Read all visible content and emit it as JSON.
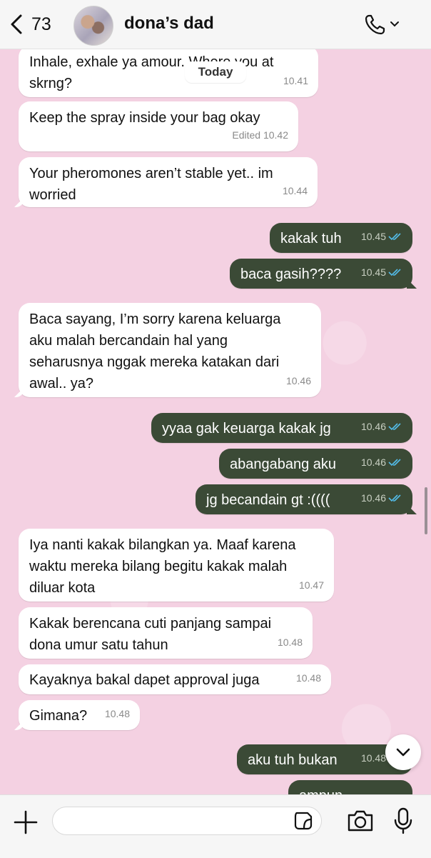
{
  "header": {
    "back_count": "73",
    "contact_name": "dona’s dad"
  },
  "date_pill": "Today",
  "messages": [
    {
      "text": "Inhale, exhale ya amour. Where you at\nskrng?",
      "time": "10.41",
      "dir": "in"
    },
    {
      "text": "Keep the spray inside your bag okay",
      "time": "Edited 10.42",
      "dir": "in"
    },
    {
      "text": "Your pheromones aren’t stable yet.. im\nworried",
      "time": "10.44",
      "dir": "in"
    },
    {
      "text": "kakak tuh",
      "time": "10.45",
      "dir": "out"
    },
    {
      "text": "baca gasih????",
      "time": "10.45",
      "dir": "out"
    },
    {
      "text": "Baca sayang, I’m sorry karena keluarga\naku malah bercandain hal yang\nseharusnya nggak mereka katakan dari\nawal.. ya?",
      "time": "10.46",
      "dir": "in"
    },
    {
      "text": "yyaa gak keuarga kakak jg",
      "time": "10.46",
      "dir": "out"
    },
    {
      "text": "abangabang aku",
      "time": "10.46",
      "dir": "out"
    },
    {
      "text": "jg becandain gt :((((",
      "time": "10.46",
      "dir": "out"
    },
    {
      "text": "Iya nanti kakak bilangkan ya. Maaf karena\nwaktu mereka bilang begitu kakak malah\ndiluar kota",
      "time": "10.47",
      "dir": "in"
    },
    {
      "text": "Kakak berencana cuti panjang sampai\ndona umur satu tahun",
      "time": "10.48",
      "dir": "in"
    },
    {
      "text": "Kayaknya bakal dapet approval juga",
      "time": "10.48",
      "dir": "in"
    },
    {
      "text": "Gimana?",
      "time": "10.48",
      "dir": "in"
    },
    {
      "text": "aku tuh bukan",
      "time": "10.48",
      "dir": "out"
    },
    {
      "text": "ampun",
      "time": "",
      "dir": "out"
    }
  ],
  "composer": {
    "input_value": ""
  },
  "colors": {
    "chat_background": "#f4d1e2",
    "outgoing_bubble": "#3b4a36",
    "incoming_bubble": "#ffffff",
    "read_ticks": "#53bdeb"
  },
  "icons": [
    "chevron-left-icon",
    "phone-icon",
    "chevron-down-icon",
    "double-check-icon",
    "plus-icon",
    "sticker-icon",
    "camera-icon",
    "microphone-icon"
  ]
}
